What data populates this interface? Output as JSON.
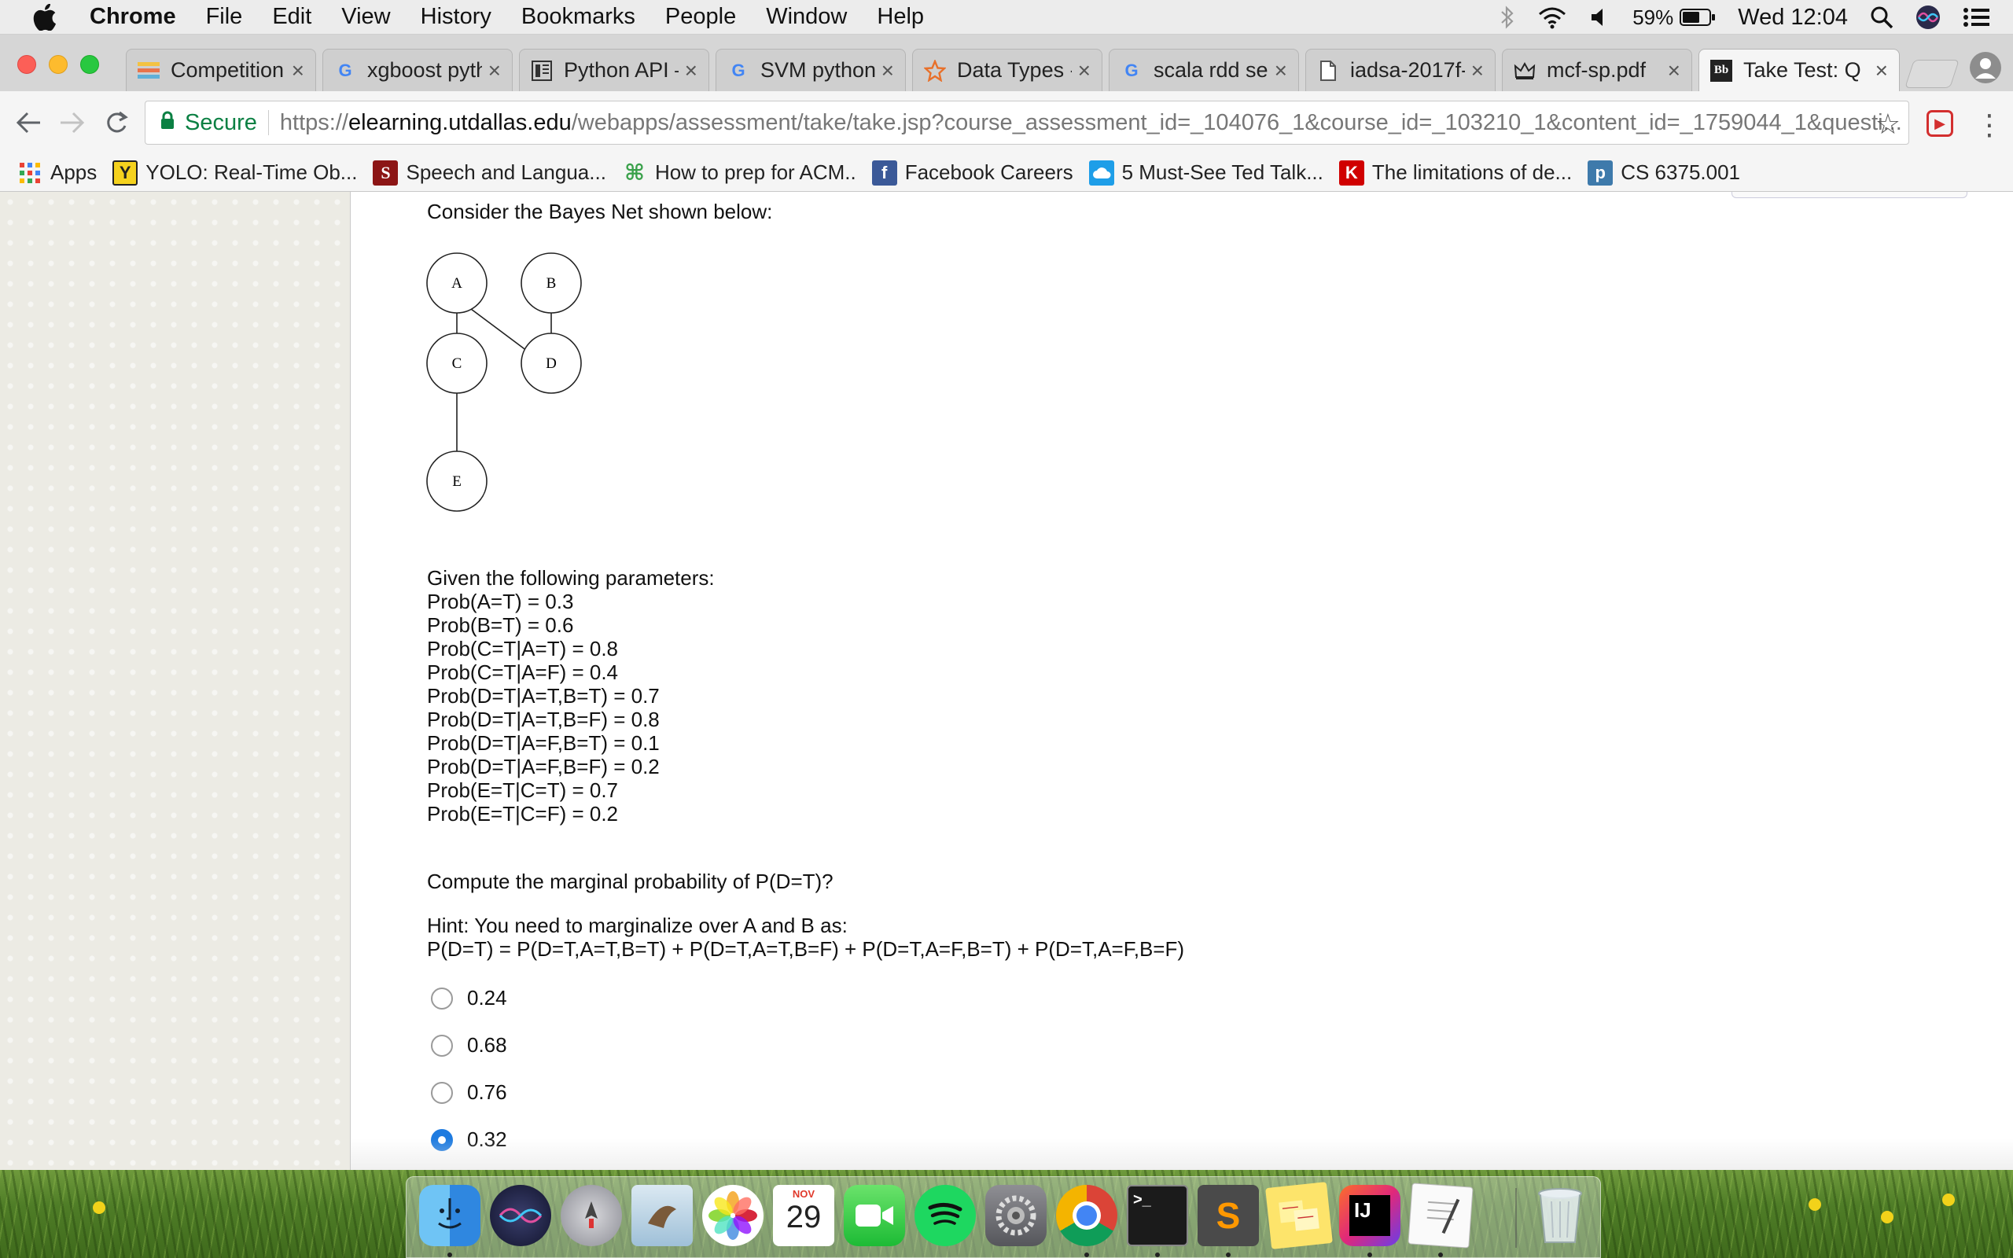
{
  "menubar": {
    "app_name": "Chrome",
    "items": [
      "File",
      "Edit",
      "View",
      "History",
      "Bookmarks",
      "People",
      "Window",
      "Help"
    ],
    "battery": "59%",
    "clock": "Wed 12:04"
  },
  "tabs": [
    {
      "title": "Competition",
      "icon": "kaggle-icon"
    },
    {
      "title": "xgboost pyth",
      "icon": "google-icon"
    },
    {
      "title": "Python API –",
      "icon": "docs-icon"
    },
    {
      "title": "SVM python",
      "icon": "google-icon"
    },
    {
      "title": "Data Types -",
      "icon": "star-icon"
    },
    {
      "title": "scala rdd sel",
      "icon": "google-icon"
    },
    {
      "title": "iadsa-2017f-",
      "icon": "page-icon"
    },
    {
      "title": "mcf-sp.pdf",
      "icon": "crown-icon"
    },
    {
      "title": "Take Test: Q",
      "icon": "blackboard-icon",
      "active": true
    }
  ],
  "omnibox": {
    "secure_label": "Secure",
    "url_scheme": "https://",
    "url_host": "elearning.utdallas.edu",
    "url_path": "/webapps/assessment/take/take.jsp?course_assessment_id=_104076_1&course_id=_103210_1&content_id=_1759044_1&questi..."
  },
  "bookmarks": [
    {
      "label": "Apps",
      "icon": "apps-grid-icon"
    },
    {
      "label": "YOLO: Real-Time Ob...",
      "icon": "yolo-icon"
    },
    {
      "label": "Speech and Langua...",
      "icon": "stanford-icon"
    },
    {
      "label": "How to prep for ACM..",
      "icon": "hackerrank-icon"
    },
    {
      "label": "Facebook Careers",
      "icon": "facebook-icon"
    },
    {
      "label": "5 Must-See Ted Talk...",
      "icon": "cloud-icon"
    },
    {
      "label": "The limitations of de...",
      "icon": "keras-icon"
    },
    {
      "label": "CS 6375.001",
      "icon": "piazza-icon"
    }
  ],
  "question": {
    "intro": "Consider the Bayes Net shown below:",
    "nodes": [
      "A",
      "B",
      "C",
      "D",
      "E"
    ],
    "params_heading": "Given the following parameters:",
    "params": [
      "Prob(A=T) = 0.3",
      "Prob(B=T) = 0.6",
      "Prob(C=T|A=T) = 0.8",
      "Prob(C=T|A=F) = 0.4",
      "Prob(D=T|A=T,B=T) = 0.7",
      "Prob(D=T|A=T,B=F) = 0.8",
      "Prob(D=T|A=F,B=T) = 0.1",
      "Prob(D=T|A=F,B=F) = 0.2",
      "Prob(E=T|C=T) = 0.7",
      "Prob(E=T|C=F) = 0.2"
    ],
    "prompt": "Compute the marginal probability of P(D=T)?",
    "hint_line1": "Hint: You need to marginalize over A and B as:",
    "hint_line2": "P(D=T) = P(D=T,A=T,B=T) + P(D=T,A=T,B=F) + P(D=T,A=F,B=T) + P(D=T,A=F,B=F)",
    "options": [
      {
        "label": "0.24",
        "selected": false
      },
      {
        "label": "0.68",
        "selected": false
      },
      {
        "label": "0.76",
        "selected": false
      },
      {
        "label": "0.32",
        "selected": true
      }
    ]
  },
  "dock": {
    "calendar_month": "NOV",
    "calendar_day": "29",
    "apps": [
      "finder-icon",
      "siri-icon",
      "launchpad-icon",
      "mail-icon",
      "photos-icon",
      "calendar-icon",
      "facetime-icon",
      "spotify-icon",
      "system-preferences-icon",
      "chrome-icon",
      "terminal-icon",
      "sublime-text-icon",
      "stickies-icon",
      "intellij-icon",
      "textedit-icon",
      "trash-icon"
    ]
  }
}
